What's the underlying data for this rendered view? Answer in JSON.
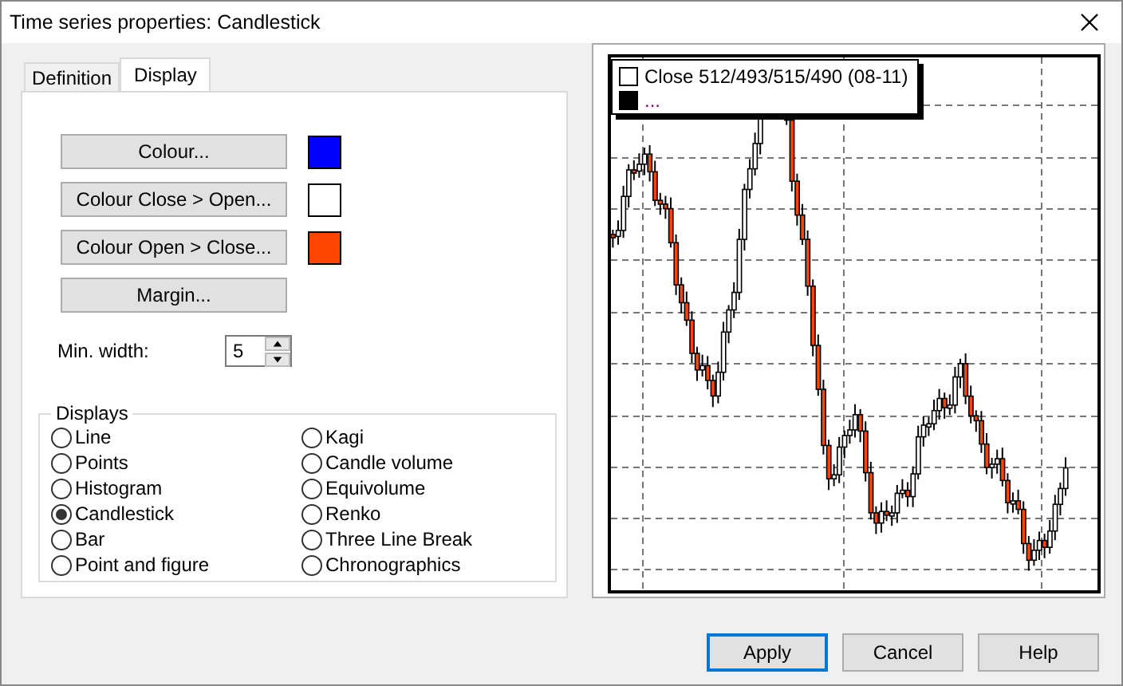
{
  "window": {
    "title": "Time series properties: Candlestick"
  },
  "tabs": [
    {
      "label": "Definition",
      "selected": false
    },
    {
      "label": "Display",
      "selected": true
    }
  ],
  "colour_buttons": [
    {
      "label": "Colour...",
      "color": "#0000ff"
    },
    {
      "label": "Colour Close > Open...",
      "color": "#ffffff"
    },
    {
      "label": "Colour Open > Close...",
      "color": "#ff4500"
    }
  ],
  "margin_button": "Margin...",
  "min_width": {
    "label": "Min. width:",
    "value": "5"
  },
  "displays": {
    "title": "Displays",
    "options": [
      {
        "label": "Line",
        "selected": false
      },
      {
        "label": "Points",
        "selected": false
      },
      {
        "label": "Histogram",
        "selected": false
      },
      {
        "label": "Candlestick",
        "selected": true
      },
      {
        "label": "Bar",
        "selected": false
      },
      {
        "label": "Point and figure",
        "selected": false
      },
      {
        "label": "Kagi",
        "selected": false
      },
      {
        "label": "Candle volume",
        "selected": false
      },
      {
        "label": "Equivolume",
        "selected": false
      },
      {
        "label": "Renko",
        "selected": false
      },
      {
        "label": "Three Line Break",
        "selected": false
      },
      {
        "label": "Chronographics",
        "selected": false
      }
    ]
  },
  "chart": {
    "legend": [
      {
        "label": "Close 512/493/515/490 (08-11)",
        "color": "#ffffff"
      },
      {
        "label": "...",
        "color": "#000000"
      }
    ]
  },
  "buttons": [
    {
      "label": "Apply",
      "default": true
    },
    {
      "label": "Cancel",
      "default": false
    },
    {
      "label": "Help",
      "default": false
    }
  ]
}
